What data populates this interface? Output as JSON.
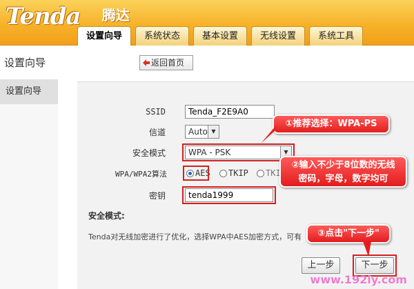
{
  "brand": {
    "logo": "Tenda",
    "logo_cn": "腾达"
  },
  "tabs": [
    {
      "label": "设置向导",
      "active": true
    },
    {
      "label": "系统状态"
    },
    {
      "label": "基本设置"
    },
    {
      "label": "无线设置"
    },
    {
      "label": "系统工具"
    }
  ],
  "sidebar": {
    "title": "设置向导",
    "item": "设置向导"
  },
  "home_button": "返回首页",
  "form": {
    "ssid": {
      "label": "SSID",
      "value": "Tenda_F2E9A0"
    },
    "channel": {
      "label": "信道",
      "value": "Auto"
    },
    "security_mode": {
      "label": "安全模式",
      "value": "WPA - PSK"
    },
    "algorithm": {
      "label": "WPA/WPA2算法",
      "options": [
        {
          "label": "AES",
          "checked": true
        },
        {
          "label": "TKIP"
        },
        {
          "label": "TKIP"
        }
      ]
    },
    "key": {
      "label": "密钥",
      "value": "tenda1999"
    }
  },
  "section_title": "安全模式:",
  "description": "Tenda对无线加密进行了优化，选择WPA中AES加密方式，可有",
  "callouts": {
    "one": "①推荐选择：WPA-PS",
    "two_line1": "②输入不少于8位数的无线",
    "two_line2": "密码，字母，数字均可",
    "three": "③点击\"下一步\""
  },
  "buttons": {
    "prev": "上一步",
    "next": "下一步"
  },
  "watermark": "www.192ly.com",
  "colors": {
    "header": "#f7b22a",
    "highlight": "#d41f1f",
    "callout": "#e31d1d"
  }
}
